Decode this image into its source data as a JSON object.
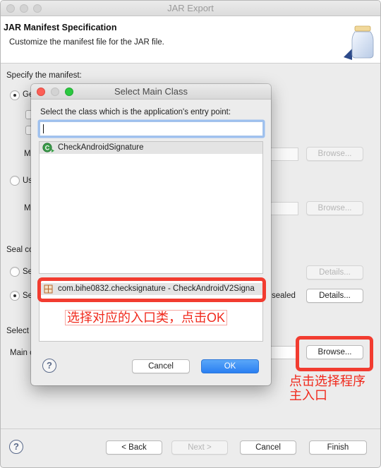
{
  "window": {
    "title": "JAR Export"
  },
  "header": {
    "title": "JAR Manifest Specification",
    "description": "Customize the manifest file for the JAR file."
  },
  "manifest_section": {
    "label": "Specify the manifest:",
    "generate_radio_label": "Ge",
    "use_existing_radio_label": "Us",
    "manifest_label_1": "Ma",
    "manifest_label_2": "Ma",
    "browse_label_1": "Browse...",
    "browse_label_2": "Browse..."
  },
  "seal_section": {
    "label": "Seal co",
    "seal_jar_radio_label": "Se",
    "seal_packages_radio_label": "Se",
    "sealed_suffix": "sealed",
    "details_label_1": "Details...",
    "details_label_2": "Details..."
  },
  "main_class_section": {
    "label": "Select",
    "main_class_label": "Main c",
    "browse_label": "Browse..."
  },
  "footer": {
    "back_label": "< Back",
    "next_label": "Next >",
    "cancel_label": "Cancel",
    "finish_label": "Finish",
    "help_symbol": "?"
  },
  "dialog": {
    "title": "Select Main Class",
    "prompt": "Select the class which is the application's entry point:",
    "filter_value": "",
    "matching_items": [
      {
        "label": "CheckAndroidSignature",
        "icon": "class-icon"
      }
    ],
    "qualifier_items": [
      {
        "label": "com.bihe0832.checksignature - CheckAndroidV2Signa",
        "icon": "package-icon"
      }
    ],
    "cancel_label": "Cancel",
    "ok_label": "OK",
    "help_symbol": "?"
  },
  "annotations": {
    "dialog_note": "选择对应的入口类，点击OK",
    "browse_note_line1": "点击选择程序",
    "browse_note_line2": "主入口",
    "color": "#f23c30"
  }
}
